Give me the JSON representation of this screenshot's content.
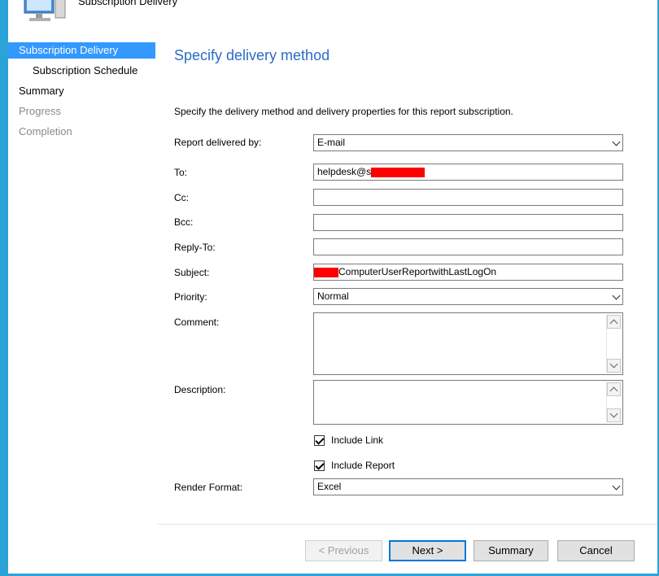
{
  "window": {
    "title": "Subscription Delivery"
  },
  "nav": {
    "items": [
      {
        "label": "Subscription Delivery",
        "state": "active"
      },
      {
        "label": "Subscription Schedule",
        "state": "normal"
      },
      {
        "label": "Summary",
        "state": "normal"
      },
      {
        "label": "Progress",
        "state": "disabled"
      },
      {
        "label": "Completion",
        "state": "disabled"
      }
    ]
  },
  "page": {
    "heading": "Specify delivery method",
    "intro": "Specify the delivery method and delivery properties for this report subscription."
  },
  "form": {
    "delivered_by": {
      "label": "Report delivered by:",
      "value": "E-mail"
    },
    "to": {
      "label": "To:",
      "value": "helpdesk@s"
    },
    "cc": {
      "label": "Cc:",
      "value": ""
    },
    "bcc": {
      "label": "Bcc:",
      "value": ""
    },
    "reply_to": {
      "label": "Reply-To:",
      "value": ""
    },
    "subject": {
      "label": "Subject:",
      "value": "ComputerUserReportwithLastLogOn"
    },
    "priority": {
      "label": "Priority:",
      "value": "Normal"
    },
    "comment": {
      "label": "Comment:",
      "value": ""
    },
    "description": {
      "label": "Description:",
      "value": ""
    },
    "include_link": {
      "label": "Include Link",
      "checked": true
    },
    "include_report": {
      "label": "Include Report",
      "checked": true
    },
    "render_format": {
      "label": "Render Format:",
      "value": "Excel"
    }
  },
  "buttons": {
    "previous": "< Previous",
    "next": "Next >",
    "summary": "Summary",
    "cancel": "Cancel"
  },
  "colors": {
    "accent": "#3399ff",
    "heading": "#2a6cc4",
    "redaction": "#ff0000",
    "frame": "#2aa3d8"
  },
  "icons": [
    "computer-icon",
    "chevron-down-icon",
    "scroll-up-icon",
    "scroll-down-icon",
    "checkmark-icon"
  ]
}
